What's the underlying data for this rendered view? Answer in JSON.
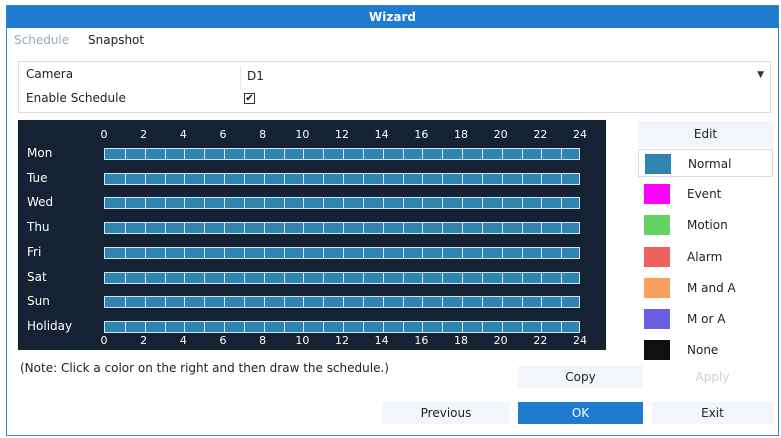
{
  "window": {
    "title": "Wizard"
  },
  "tabs": [
    {
      "label": "Schedule",
      "active": false
    },
    {
      "label": "Snapshot",
      "active": true
    }
  ],
  "form": {
    "camera_label": "Camera",
    "camera_value": "D1",
    "enable_schedule_label": "Enable Schedule",
    "enable_schedule_checked": true,
    "check_glyph": "✔"
  },
  "schedule": {
    "hour_labels": [
      "0",
      "2",
      "4",
      "6",
      "8",
      "10",
      "12",
      "14",
      "16",
      "18",
      "20",
      "22",
      "24"
    ],
    "days": [
      "Mon",
      "Tue",
      "Wed",
      "Thu",
      "Fri",
      "Sat",
      "Sun",
      "Holiday"
    ],
    "default_type": "Normal"
  },
  "legend": {
    "edit_label": "Edit",
    "items": [
      {
        "label": "Normal",
        "color": "#2f84b0",
        "selected": true
      },
      {
        "label": "Event",
        "color": "#ff00ff",
        "selected": false
      },
      {
        "label": "Motion",
        "color": "#63d263",
        "selected": false
      },
      {
        "label": "Alarm",
        "color": "#ef6060",
        "selected": false
      },
      {
        "label": "M and A",
        "color": "#f7a15c",
        "selected": false
      },
      {
        "label": "M or A",
        "color": "#6a5fe3",
        "selected": false
      },
      {
        "label": "None",
        "color": "#111111",
        "selected": false
      }
    ]
  },
  "note": "(Note: Click a color on the right and then draw the schedule.)",
  "buttons": {
    "copy": "Copy",
    "apply": "Apply",
    "previous": "Previous",
    "ok": "OK",
    "exit": "Exit"
  }
}
